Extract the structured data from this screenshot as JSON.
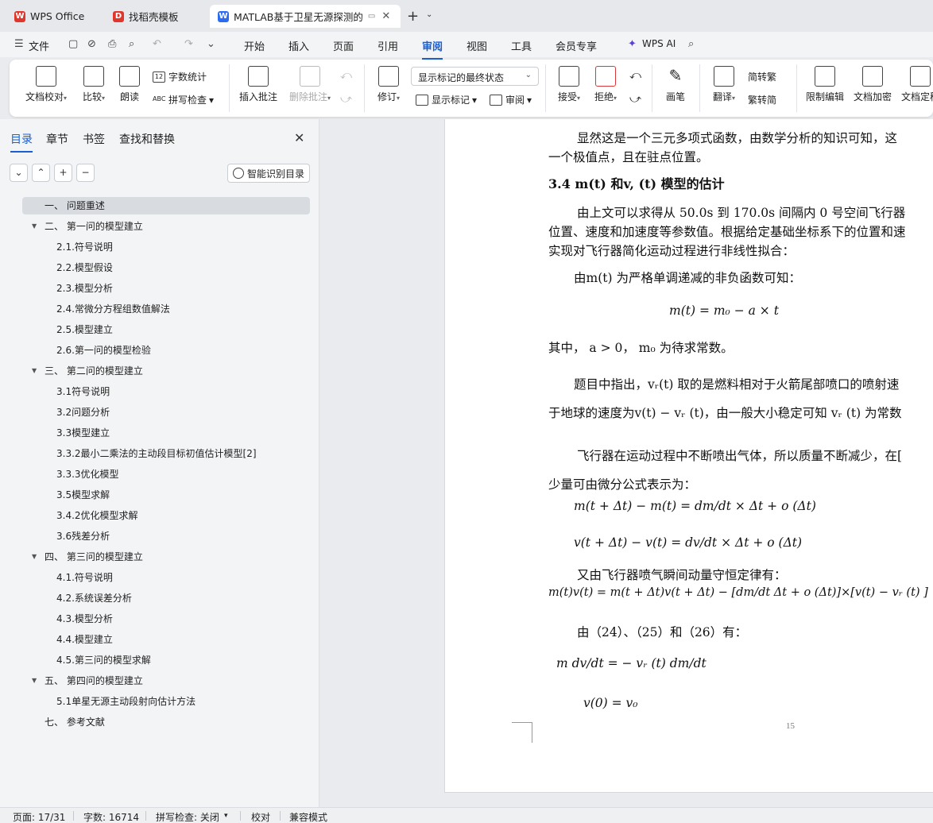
{
  "tabs": [
    {
      "label": "WPS Office",
      "icon": "wps-logo-icon",
      "color": "#e0362b"
    },
    {
      "label": "找稻壳模板",
      "icon": "docer-icon",
      "color": "#e0362b"
    },
    {
      "label": "MATLAB基于卫星无源探测的",
      "icon": "word-doc-icon",
      "color": "#2b6df2"
    }
  ],
  "menu": {
    "file": "文件",
    "items": [
      "开始",
      "插入",
      "页面",
      "引用",
      "审阅",
      "视图",
      "工具",
      "会员专享"
    ],
    "active": "审阅",
    "wps_ai": "WPS AI"
  },
  "ribbon": {
    "doc_check": "文档校对",
    "compare": "比较",
    "read_aloud": "朗读",
    "word_count": "字数统计",
    "spell_check": "拼写检查",
    "insert_comment": "插入批注",
    "delete_comment": "删除批注",
    "revise": "修订",
    "markup_select": "显示标记的最终状态",
    "show_markup": "显示标记",
    "review": "审阅",
    "accept": "接受",
    "reject": "拒绝",
    "pen": "画笔",
    "translate": "翻译",
    "to_traditional": "简转繁",
    "to_simplified": "繁转简",
    "restrict_edit": "限制编辑",
    "doc_encrypt": "文档加密",
    "doc_finalize": "文档定稿"
  },
  "sidebar": {
    "tabs": [
      "目录",
      "章节",
      "书签",
      "查找和替换"
    ],
    "active_tab": "目录",
    "smart_toc": "智能识别目录",
    "toc": [
      {
        "label": "一、 问题重述",
        "level": 0,
        "expand": false,
        "selected": true
      },
      {
        "label": "二、 第一问的模型建立",
        "level": 0,
        "expand": true
      },
      {
        "label": "2.1.符号说明",
        "level": 1
      },
      {
        "label": "2.2.模型假设",
        "level": 1
      },
      {
        "label": "2.3.模型分析",
        "level": 1
      },
      {
        "label": "2.4.常微分方程组数值解法",
        "level": 1
      },
      {
        "label": "2.5.模型建立",
        "level": 1
      },
      {
        "label": "2.6.第一问的模型检验",
        "level": 1
      },
      {
        "label": "三、 第二问的模型建立",
        "level": 0,
        "expand": true
      },
      {
        "label": "3.1符号说明",
        "level": 1
      },
      {
        "label": "3.2问题分析",
        "level": 1
      },
      {
        "label": "3.3模型建立",
        "level": 1
      },
      {
        "label": "3.3.2最小二乘法的主动段目标初值估计模型[2]",
        "level": 1
      },
      {
        "label": "3.3.3优化模型",
        "level": 1
      },
      {
        "label": "3.5模型求解",
        "level": 1
      },
      {
        "label": "3.4.2优化模型求解",
        "level": 1
      },
      {
        "label": "3.6残差分析",
        "level": 1
      },
      {
        "label": "四、 第三问的模型建立",
        "level": 0,
        "expand": true
      },
      {
        "label": "4.1.符号说明",
        "level": 1
      },
      {
        "label": "4.2.系统误差分析",
        "level": 1
      },
      {
        "label": "4.3.模型分析",
        "level": 1
      },
      {
        "label": "4.4.模型建立",
        "level": 1
      },
      {
        "label": "4.5.第三问的模型求解",
        "level": 1
      },
      {
        "label": "五、 第四问的模型建立",
        "level": 0,
        "expand": true
      },
      {
        "label": "5.1单星无源主动段射向估计方法",
        "level": 1
      },
      {
        "label": "七、 参考文献",
        "level": 0,
        "expand": false
      }
    ]
  },
  "document": {
    "lines": [
      "显然这是一个三元多项式函数，由数学分析的知识可知，这",
      "一个极值点，且在驻点位置。",
      "3.4 m(t) 和v, (t) 模型的估计",
      "由上文可以求得从 50.0s 到 170.0s 间隔内 0 号空间飞行器",
      "位置、速度和加速度等参数值。根据给定基础坐标系下的位置和速",
      "实现对飞行器简化运动过程进行非线性拟合：",
      "由m(t) 为严格单调递减的非负函数可知：",
      "m(t) = m₀ − a × t",
      "其中，  a > 0，  m₀ 为待求常数。",
      "题目中指出，vᵣ(t) 取的是燃料相对于火箭尾部喷口的喷射速",
      "于地球的速度为v(t) − vᵣ (t)，由一般大小稳定可知 vᵣ (t) 为常数",
      "飞行器在运动过程中不断喷出气体，所以质量不断减少，在[",
      "少量可由微分公式表示为：",
      "m(t + Δt) − m(t) = dm/dt × Δt + o (Δt)",
      "v(t + Δt) − v(t) = dv/dt × Δt + o (Δt)",
      "又由飞行器喷气瞬间动量守恒定律有：",
      "m(t)v(t) = m(t + Δt)v(t + Δt) − [dm/dt Δt + o (Δt)]×[v(t) − vᵣ (t) ]",
      "由（24）、（25）和（26）有：",
      "m dv/dt = − vᵣ (t) dm/dt",
      "v(0) = v₀"
    ],
    "page_number": "15"
  },
  "status": {
    "page": "页面: 17/31",
    "words": "字数: 16714",
    "spell": "拼写检查: 关闭",
    "proof": "校对",
    "compat": "兼容模式"
  }
}
